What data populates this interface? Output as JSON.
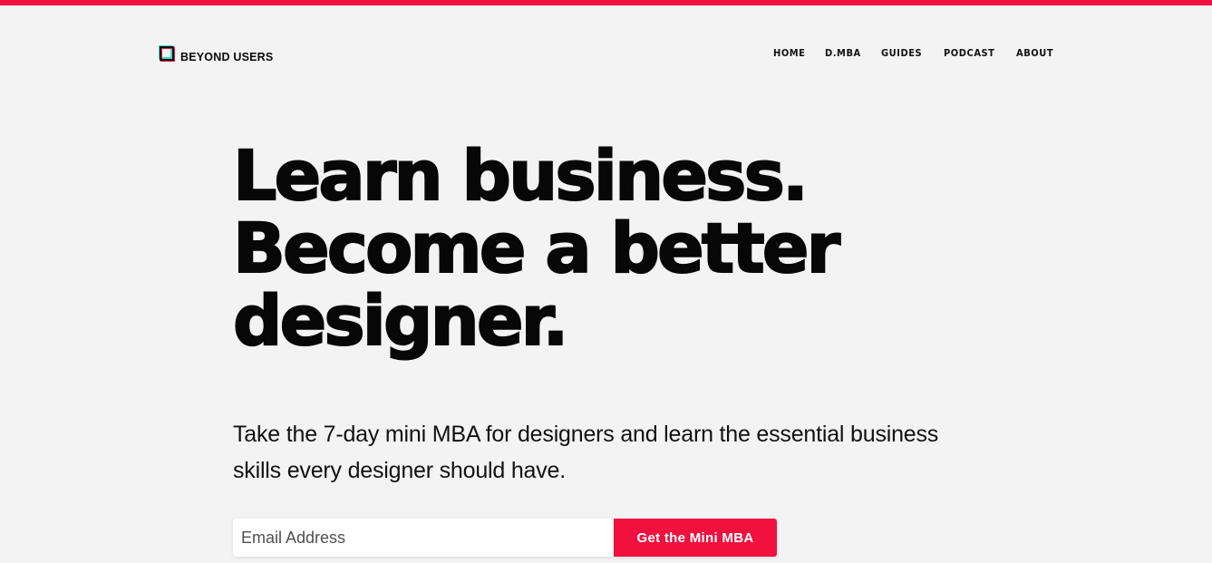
{
  "brand": {
    "name": "BEYOND USERS",
    "accent_color": "#f0113f",
    "secondary_color": "#41d6c8",
    "logo_icon": "overlapping-squares-icon"
  },
  "nav": {
    "items": [
      {
        "label": "HOME"
      },
      {
        "label": "D.MBA"
      },
      {
        "label": "GUIDES"
      },
      {
        "label": "PODCAST"
      },
      {
        "label": "ABOUT"
      }
    ]
  },
  "hero": {
    "lines": [
      "Learn business.",
      "Become a better",
      "designer."
    ],
    "subtitle": "Take the 7-day mini MBA for designers and learn the essential business skills every designer should have."
  },
  "signup": {
    "email_placeholder": "Email Address",
    "email_value": "",
    "button_label": "Get the Mini MBA"
  }
}
